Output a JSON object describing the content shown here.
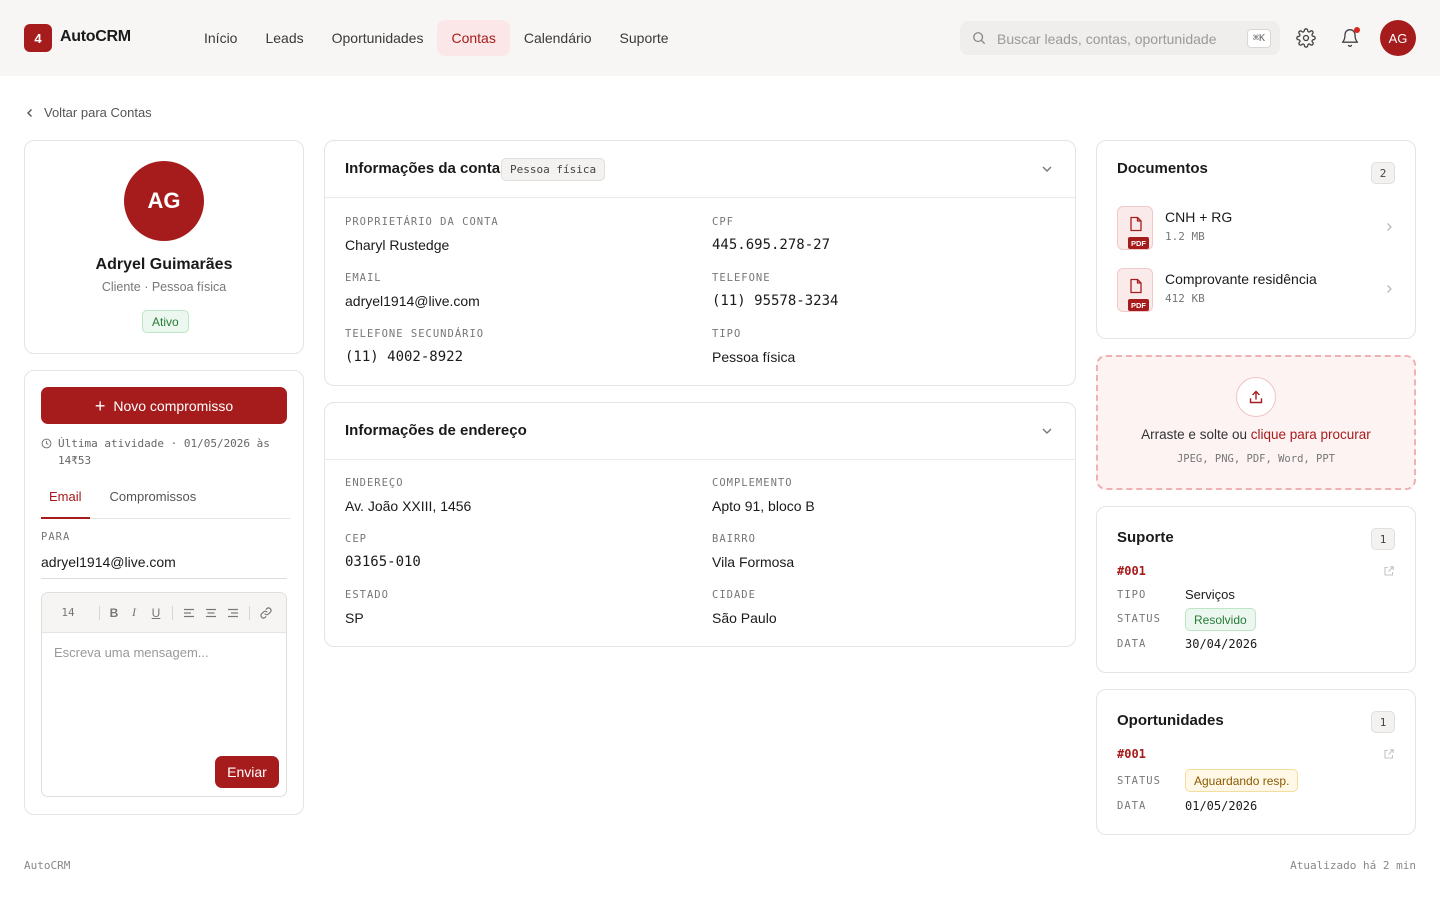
{
  "app": {
    "logo_badge": "4",
    "name": "AutoCRM"
  },
  "nav": {
    "items": [
      {
        "label": "Início"
      },
      {
        "label": "Leads"
      },
      {
        "label": "Oportunidades"
      },
      {
        "label": "Contas",
        "active": true
      },
      {
        "label": "Calendário"
      },
      {
        "label": "Suporte"
      }
    ]
  },
  "search": {
    "placeholder": "Buscar leads, contas, oportunidade",
    "shortcut": "⌘K"
  },
  "user": {
    "initials": "AG"
  },
  "back_link": "Voltar para Contas",
  "profile": {
    "initials": "AG",
    "name": "Adryel Guimarães",
    "subtitle": "Cliente · Pessoa física",
    "status": "Ativo"
  },
  "activity": {
    "new_button": "Novo compromisso",
    "last_activity": "Última atividade · 01/05/2026 às 14₹53",
    "tabs": [
      "Email",
      "Compromissos"
    ],
    "to_label": "PARA",
    "to_value": "adryel1914@live.com",
    "font_size": "14",
    "message_placeholder": "Escreva uma mensagem...",
    "send_label": "Enviar"
  },
  "account_info": {
    "title": "Informações da conta",
    "tag": "Pessoa física",
    "fields": [
      {
        "label": "PROPRIETÁRIO DA CONTA",
        "value": "Charyl Rustedge"
      },
      {
        "label": "CPF",
        "value": "445.695.278-27"
      },
      {
        "label": "EMAIL",
        "value": "adryel1914@live.com"
      },
      {
        "label": "TELEFONE",
        "value": "(11) 95578-3234"
      },
      {
        "label": "TELEFONE SECUNDÁRIO",
        "value": "(11) 4002-8922"
      },
      {
        "label": "TIPO",
        "value": "Pessoa física"
      }
    ]
  },
  "address_info": {
    "title": "Informações de endereço",
    "fields": [
      {
        "label": "ENDEREÇO",
        "value": "Av. João XXIII, 1456"
      },
      {
        "label": "COMPLEMENTO",
        "value": "Apto 91, bloco B"
      },
      {
        "label": "CEP",
        "value": "03165-010"
      },
      {
        "label": "BAIRRO",
        "value": "Vila Formosa"
      },
      {
        "label": "ESTADO",
        "value": "SP"
      },
      {
        "label": "CIDADE",
        "value": "São Paulo"
      }
    ]
  },
  "documents": {
    "title": "Documentos",
    "count": "2",
    "items": [
      {
        "name": "CNH + RG",
        "size": "1.2 MB",
        "type": "PDF"
      },
      {
        "name": "Comprovante residência",
        "size": "412 KB",
        "type": "PDF"
      }
    ]
  },
  "upload": {
    "text": "Arraste e solte ou ",
    "link": "clique para procurar",
    "types": "JPEG, PNG, PDF, Word, PPT"
  },
  "support": {
    "title": "Suporte",
    "count": "1",
    "id": "#001",
    "type_label": "TIPO",
    "type_value": "Serviços",
    "status_label": "STATUS",
    "status_value": "Resolvido",
    "date_label": "DATA",
    "date_value": "30/04/2026"
  },
  "opportunities": {
    "title": "Oportunidades",
    "count": "1",
    "id": "#001",
    "status_label": "STATUS",
    "status_value": "Aguardando resp.",
    "date_label": "DATA",
    "date_value": "01/05/2026"
  },
  "footer": {
    "left": "AutoCRM",
    "right": "Atualizado há 2 min"
  },
  "colors": {
    "brand": "#a61c1c",
    "success": "#257a38",
    "warning": "#8a5a00"
  }
}
